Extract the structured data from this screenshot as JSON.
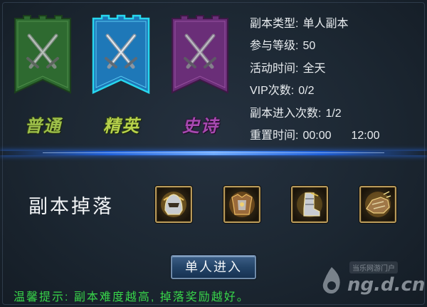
{
  "tiers": [
    {
      "label": "普通",
      "icon": "crossed-swords-icon",
      "color": "#2e6a30"
    },
    {
      "label": "精英",
      "icon": "crossed-swords-icon",
      "color": "#1e78b8"
    },
    {
      "label": "史诗",
      "icon": "crossed-swords-icon",
      "color": "#6a2e78"
    }
  ],
  "info": {
    "type_label": "副本类型:",
    "type_value": "单人副本",
    "level_label": "参与等级:",
    "level_value": "50",
    "time_label": "活动时间:",
    "time_value": "全天",
    "vip_label": "VIP次数:",
    "vip_value": "0/2",
    "entries_label": "副本进入次数:",
    "entries_value": "1/2",
    "reset_label": "重置时间:",
    "reset_value_1": "00:00",
    "reset_value_2": "12:00"
  },
  "drops": {
    "title": "副本掉落",
    "items": [
      {
        "icon": "helmet-icon"
      },
      {
        "icon": "chest-armor-icon"
      },
      {
        "icon": "boots-icon"
      },
      {
        "icon": "gauntlet-icon"
      }
    ]
  },
  "enter_button": "单人进入",
  "tip": "温馨提示: 副本难度越高, 掉落奖励越好。",
  "watermark": {
    "small": "当乐网游门户",
    "big": "ng.d.cn"
  },
  "colors": {
    "accent_blue": "#2b6ae0",
    "tip_green": "#38d64a"
  }
}
